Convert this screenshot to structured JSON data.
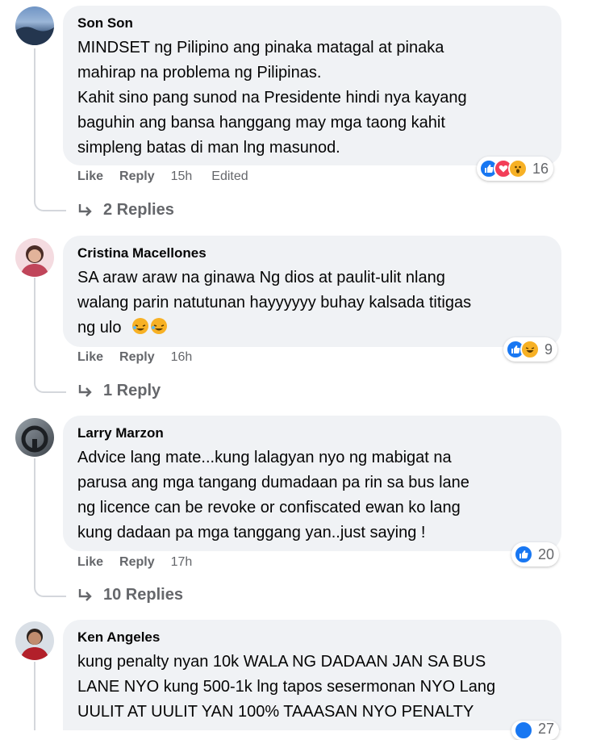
{
  "comments": [
    {
      "author": "Son Son",
      "lines": [
        "MINDSET ng Pilipino ang pinaka matagal at pinaka",
        "mahirap na problema ng Pilipinas.",
        "Kahit sino pang sunod na Presidente hindi nya kayang",
        "baguhin ang bansa hanggang may mga taong kahit",
        "simpleng batas di man lng masunod."
      ],
      "like": "Like",
      "reply": "Reply",
      "time": "15h",
      "edited": "Edited",
      "reaction_count": "16",
      "reactions": [
        "like-icon",
        "love-icon",
        "wow-icon"
      ],
      "replies": "2 Replies"
    },
    {
      "author": "Cristina Macellones",
      "lines": [
        "SA araw araw na ginawa Ng dios at paulit-ulit nlang",
        "walang parin natutunan hayyyyyy buhay kalsada titigas",
        "ng ulo"
      ],
      "like": "Like",
      "reply": "Reply",
      "time": "16h",
      "reaction_count": "9",
      "reactions": [
        "like-icon",
        "haha-icon"
      ],
      "replies": "1 Reply"
    },
    {
      "author": "Larry Marzon",
      "lines": [
        "Advice lang mate...kung lalagyan nyo ng mabigat na",
        "parusa ang mga tangang dumadaan pa rin sa bus lane",
        "ng licence can be revoke or confiscated ewan ko lang",
        "kung dadaan pa mga tanggang yan..just saying !"
      ],
      "like": "Like",
      "reply": "Reply",
      "time": "17h",
      "reaction_count": "20",
      "reactions": [
        "like-icon"
      ],
      "replies": "10 Replies"
    },
    {
      "author": "Ken Angeles",
      "lines": [
        "kung penalty nyan 10k WALA NG DADAAN JAN SA BUS",
        "LANE NYO kung 500-1k lng tapos sesermonan NYO Lang",
        "UULIT AT UULIT YAN 100% TAAASAN NYO PENALTY"
      ],
      "reaction_count": "27"
    }
  ],
  "colors": {
    "bubble": "#f0f2f5",
    "meta": "#65676b",
    "like_blue": "#1877f2",
    "love_red": "#f33e58",
    "yellow": "#f7b125"
  }
}
